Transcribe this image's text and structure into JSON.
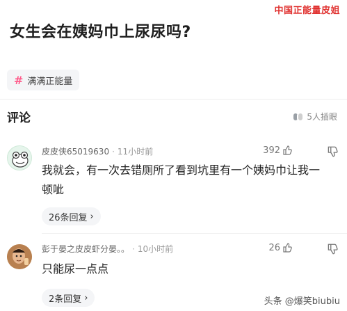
{
  "watermark_top": "中国正能量皮姐",
  "question": {
    "title": "女生会在姨妈巾上尿尿吗?"
  },
  "topic": {
    "label": "满满正能量",
    "icon": "hashtag-icon",
    "accent": "#ff5a8a"
  },
  "comments_section": {
    "title": "评论",
    "liked_by": "5人插眼"
  },
  "comments": [
    {
      "username": "皮皮侠65019630",
      "time": "11小时前",
      "likes": "392",
      "text": "我就会，有一次去错厕所了看到坑里有一个姨妈巾让我一顿呲",
      "replies": "26条回复"
    },
    {
      "username": "彭于晏之皮皮虾分晏。。",
      "time": "10小时前",
      "likes": "26",
      "text": "只能尿一点点",
      "replies": "2条回复"
    }
  ],
  "watermark_bottom": "头条 @爆笑biubiu",
  "colors": {
    "brand_red": "#e0312f",
    "hashtag_pink": "#ff5a8a"
  }
}
